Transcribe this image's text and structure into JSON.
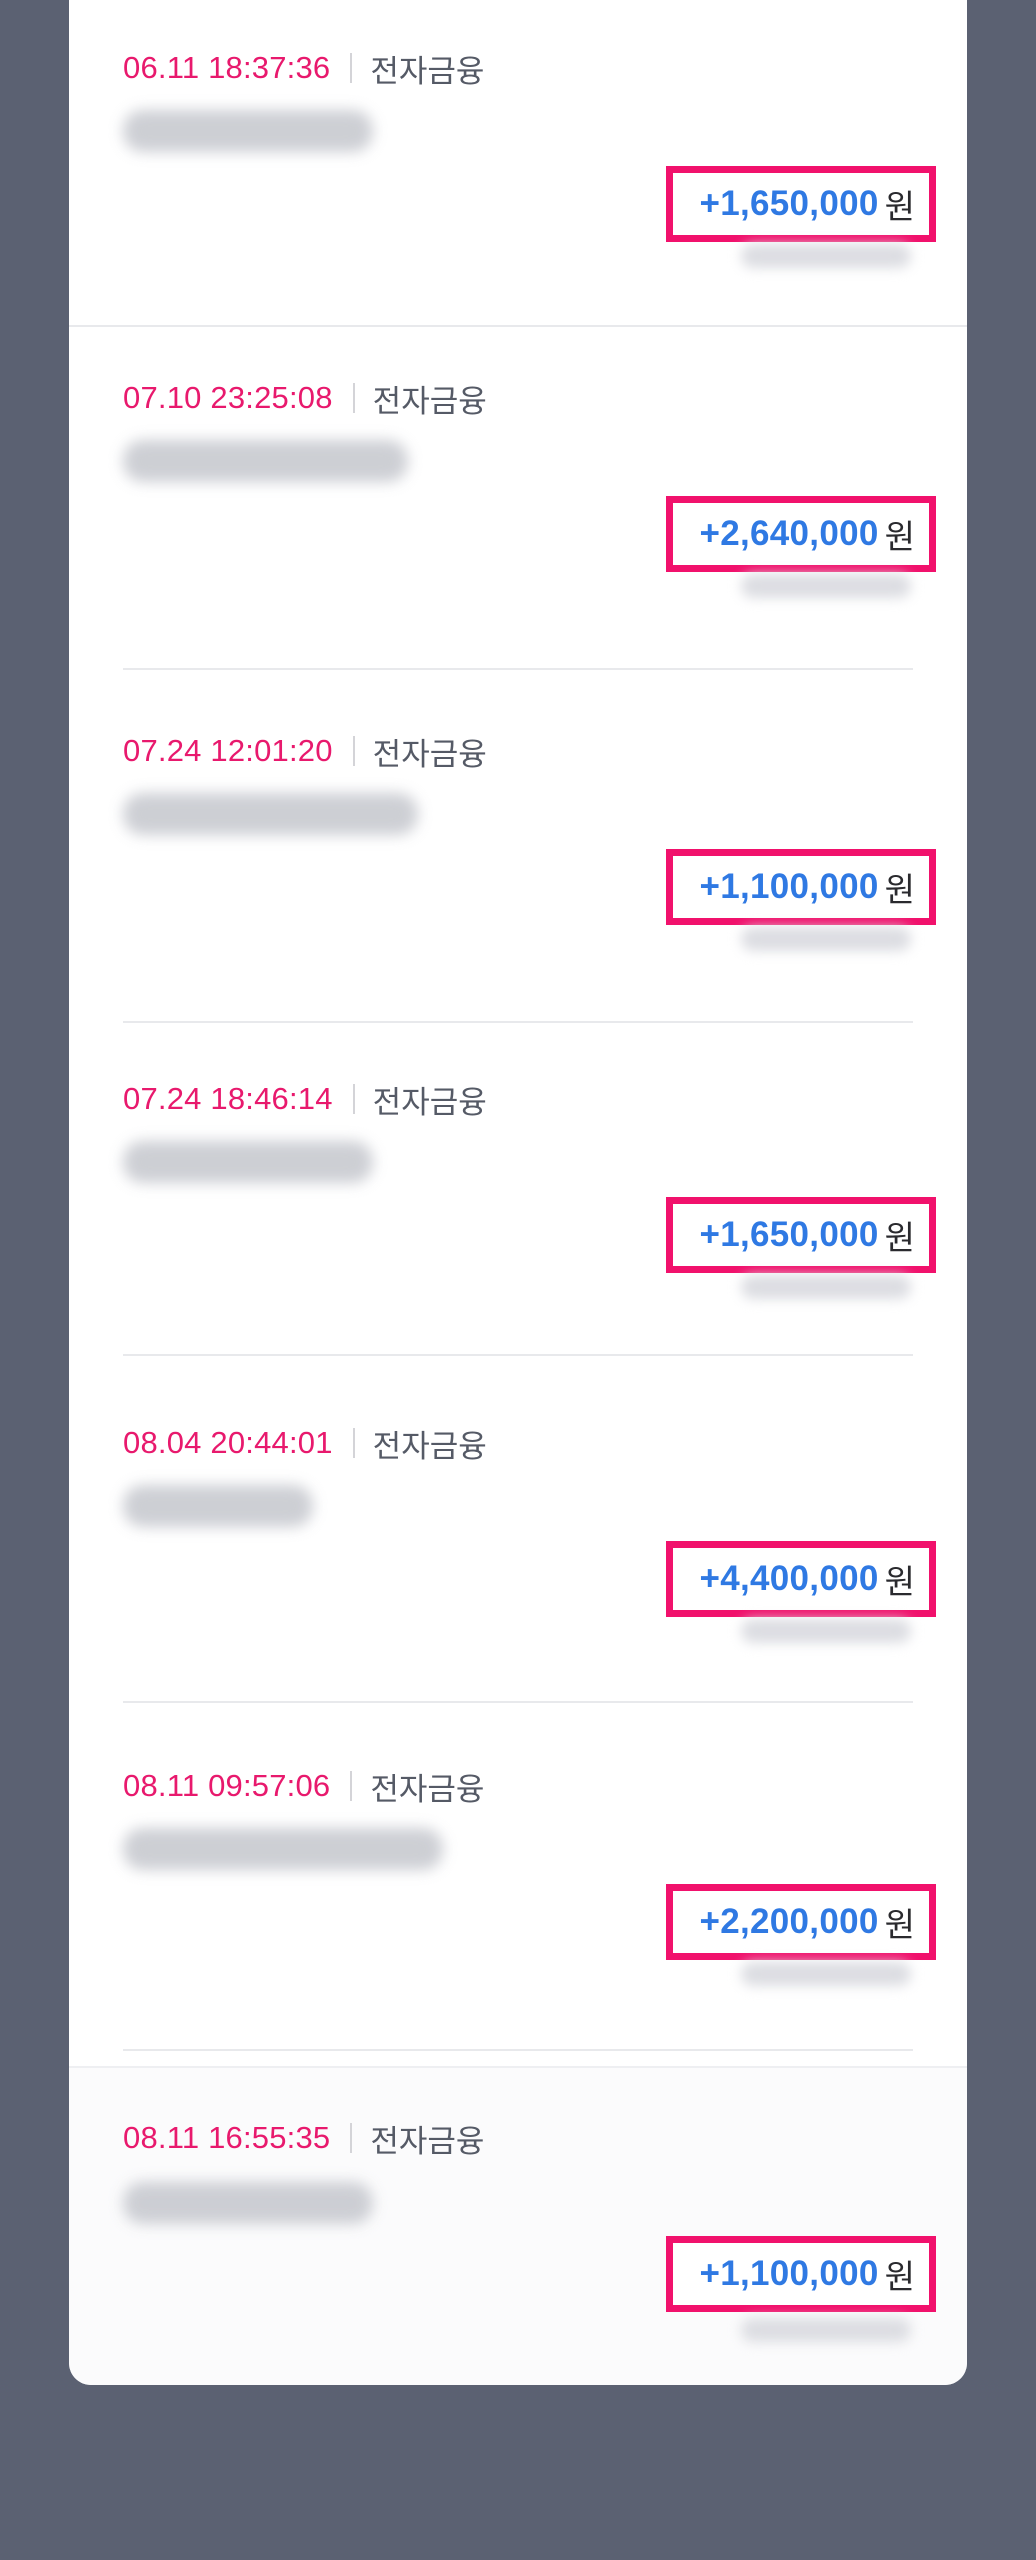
{
  "transactions": [
    {
      "time": "06.11 18:37:36",
      "method": "전자금융",
      "amount": "+1,650,000",
      "unit": "원"
    },
    {
      "time": "07.10 23:25:08",
      "method": "전자금융",
      "amount": "+2,640,000",
      "unit": "원"
    },
    {
      "time": "07.24 12:01:20",
      "method": "전자금융",
      "amount": "+1,100,000",
      "unit": "원"
    },
    {
      "time": "07.24 18:46:14",
      "method": "전자금융",
      "amount": "+1,650,000",
      "unit": "원"
    },
    {
      "time": "08.04 20:44:01",
      "method": "전자금융",
      "amount": "+4,400,000",
      "unit": "원"
    },
    {
      "time": "08.11 09:57:06",
      "method": "전자금융",
      "amount": "+2,200,000",
      "unit": "원"
    },
    {
      "time": "08.11 16:55:35",
      "method": "전자금융",
      "amount": "+1,100,000",
      "unit": "원"
    }
  ],
  "colors": {
    "background": "#5b6172",
    "time": "#e8196d",
    "amount": "#2f79e3",
    "highlight_box": "#f1116c"
  }
}
